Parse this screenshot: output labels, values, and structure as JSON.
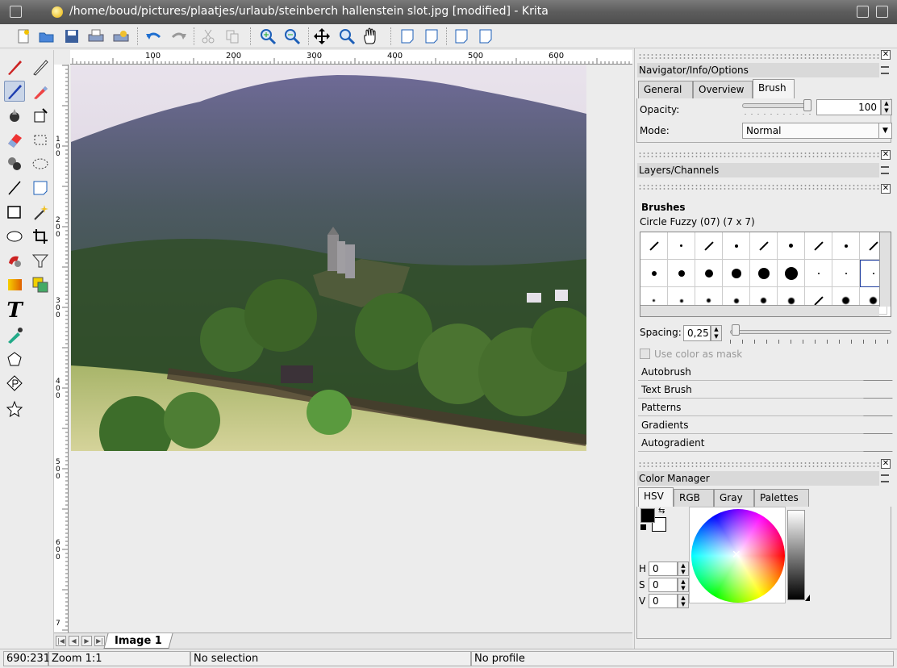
{
  "window": {
    "title": "/home/boud/pictures/plaatjes/urlaub/steinberch hallenstein slot.jpg [modified] - Krita"
  },
  "toolbar": {
    "icons": [
      "new-icon",
      "open-icon",
      "save-icon",
      "print-icon",
      "print-preview-icon",
      "undo-icon",
      "redo-icon",
      "cut-icon",
      "copy-icon",
      "zoom-in-icon",
      "zoom-out-icon",
      "move-icon",
      "zoom-icon",
      "pan-icon",
      "page-icon",
      "page-icon",
      "page-icon",
      "page-icon"
    ]
  },
  "ruler": {
    "h_ticks": [
      "100",
      "200",
      "300",
      "400",
      "500",
      "600"
    ],
    "v_ticks": [
      "1\n0\n0",
      "2\n0\n0",
      "3\n0\n0",
      "4\n0\n0",
      "5\n0\n0",
      "6\n0\n0",
      "7"
    ]
  },
  "canvas": {
    "tab_label": "Image 1"
  },
  "status": {
    "coords": "690:231",
    "zoom": "Zoom 1:1",
    "selection": "No selection",
    "profile": "No profile"
  },
  "navigator": {
    "title": "Navigator/Info/Options",
    "tabs": [
      "General",
      "Overview",
      "Brush"
    ],
    "active_tab": "Brush",
    "opacity_label": "Opacity:",
    "opacity_value": "100",
    "mode_label": "Mode:",
    "mode_value": "Normal"
  },
  "layers": {
    "title": "Layers/Channels"
  },
  "brushes": {
    "section_title": "Brushes",
    "selected_brush": "Circle Fuzzy (07) (7 x 7)",
    "spacing_label": "Spacing:",
    "spacing_value": "0,25",
    "use_color_mask": "Use color as mask",
    "other_sections": [
      "Autobrush",
      "Text Brush",
      "Patterns",
      "Gradients",
      "Autogradient"
    ]
  },
  "color_manager": {
    "title": "Color Manager",
    "tabs": [
      "HSV",
      "RGB",
      "Gray",
      "Palettes"
    ],
    "active_tab": "HSV",
    "h_label": "H",
    "h_value": "0",
    "s_label": "S",
    "s_value": "0",
    "v_label": "V",
    "v_value": "0",
    "foreground_color": "#000000",
    "background_color": "#ffffff"
  }
}
